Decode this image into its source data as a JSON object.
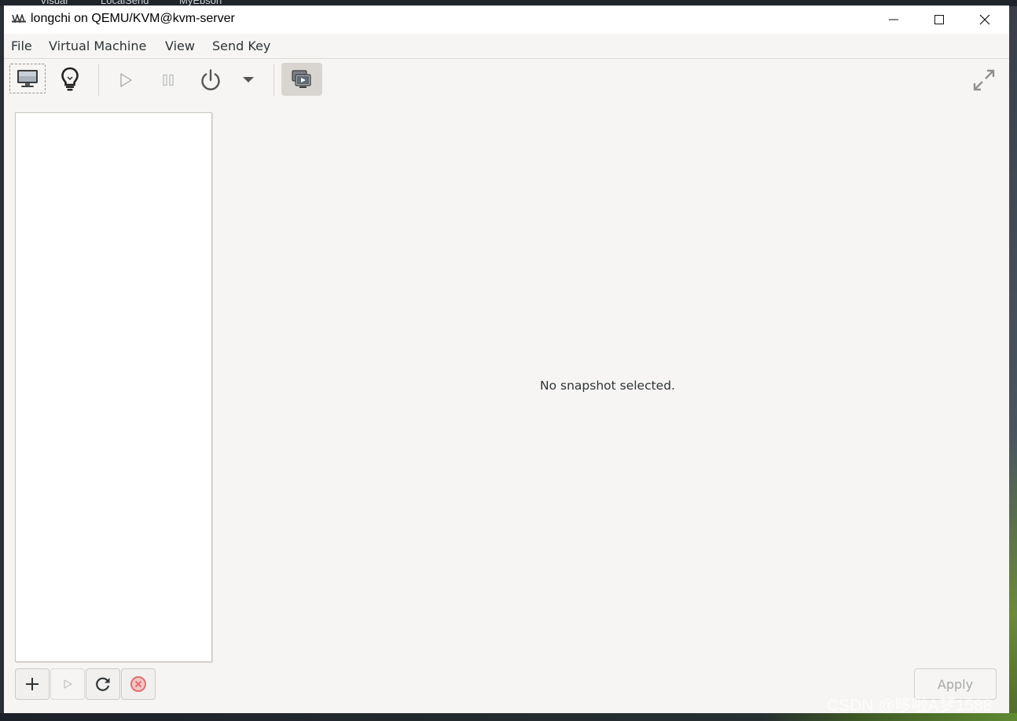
{
  "desktop": {
    "icon_labels": [
      "Visual",
      "LocalSend",
      "MyEbson"
    ]
  },
  "window": {
    "title": "longchi on QEMU/KVM@kvm-server"
  },
  "menubar": {
    "items": [
      "File",
      "Virtual Machine",
      "View",
      "Send Key"
    ]
  },
  "toolbar": {
    "buttons": [
      {
        "name": "console",
        "icon": "monitor-icon",
        "state": "active"
      },
      {
        "name": "details",
        "icon": "lightbulb-icon"
      },
      {
        "name": "run",
        "icon": "play-icon",
        "state": "disabled"
      },
      {
        "name": "pause",
        "icon": "pause-icon",
        "state": "disabled"
      },
      {
        "name": "shutdown",
        "icon": "power-icon"
      },
      {
        "name": "shutdown-menu",
        "icon": "chevron-down-icon"
      },
      {
        "name": "snapshots",
        "icon": "snapshot-icon",
        "state": "pressed"
      },
      {
        "name": "fullscreen",
        "icon": "fullscreen-icon"
      }
    ]
  },
  "snapshots": {
    "empty_message": "No snapshot selected."
  },
  "bottom_bar": {
    "buttons": [
      {
        "name": "add",
        "icon": "plus-icon"
      },
      {
        "name": "start",
        "icon": "play-icon",
        "state": "disabled"
      },
      {
        "name": "refresh",
        "icon": "refresh-icon"
      },
      {
        "name": "delete",
        "icon": "delete-icon"
      }
    ],
    "apply_label": "Apply"
  },
  "watermark": "CSDN @哆啦A梦1588",
  "colors": {
    "window_bg": "#f6f5f4",
    "titlebar_bg": "#ffffff",
    "list_bg": "#ffffff",
    "pressed_button": "#d8d5d1",
    "delete_red": "#e0706f"
  }
}
